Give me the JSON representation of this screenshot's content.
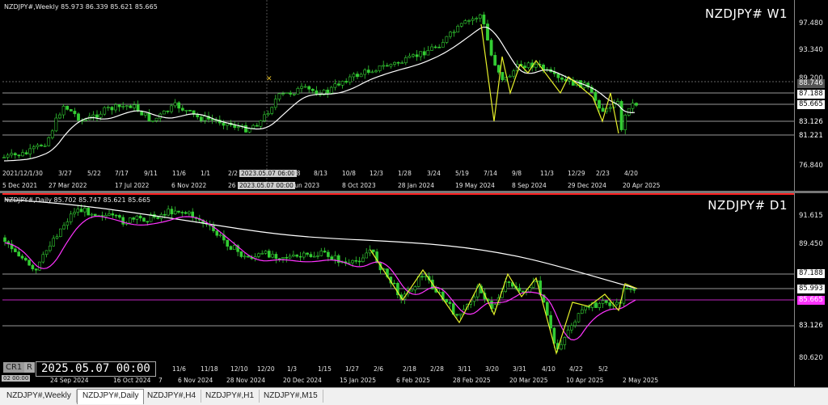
{
  "colors": {
    "bull": "#33cc33",
    "bear": "#33cc33",
    "ma_white": "#ffffff",
    "ma_magenta": "#ff33ff",
    "zigzag": "#e6f02a",
    "level": "#c8c8c8",
    "pivot_red": "#ff2020"
  },
  "top_pane": {
    "info": "NZDJPY#,Weekly  85.973 86.339 85.621 85.665",
    "big_label": "NZDJPY# W1",
    "y_ticks": [
      "97.480",
      "93.340",
      "89.200",
      "85.665",
      "83.126",
      "81.221",
      "76.840"
    ],
    "y_marks": [
      {
        "label": "88.746",
        "style": "grey"
      },
      {
        "label": "87.188",
        "style": "white"
      },
      {
        "label": "85.665",
        "style": "white"
      },
      {
        "label": "83.126",
        "style": "white"
      },
      {
        "label": "81.221",
        "style": "white"
      }
    ],
    "x_ticks": [
      "5 Dec 2021",
      "27 Mar 2022",
      "17 Jul 2022",
      "6 Nov 2022",
      "26",
      "2023.05.07 00:00",
      "Jun 2023",
      "8 Oct 2023",
      "28 Jan 2024",
      "19 May 2024",
      "8 Sep 2024",
      "29 Dec 2024",
      "20 Apr 2025"
    ],
    "x_ticks_upper": [
      "2021/12/",
      "1/30",
      "3/27",
      "5/22",
      "7/17",
      "9/11",
      "11/6",
      "1/1",
      "2/2",
      "2023.05.07 06:00",
      "18",
      "8/13",
      "10/8",
      "12/3",
      "1/28",
      "3/24",
      "5/19",
      "7/14",
      "9/8",
      "11/3",
      "12/29",
      "2/23",
      "4/20"
    ],
    "marker_symbol": "✕"
  },
  "bottom_pane": {
    "info": "NZDJPY#,Daily  85.702 85.747 85.621 85.665",
    "big_label": "NZDJPY# D1",
    "y_ticks": [
      "91.615",
      "89.450",
      "87.188",
      "85.993",
      "85.665",
      "83.126",
      "80.620"
    ],
    "y_marks": [
      {
        "label": "87.188",
        "style": "white"
      },
      {
        "label": "85.993",
        "style": "white"
      },
      {
        "label": "85.665",
        "style": "magenta"
      },
      {
        "label": "83.126",
        "style": "white"
      }
    ],
    "x_ticks": [
      "24 Sep 2024",
      "16 Oct 2024",
      "7",
      "6 Nov 2024",
      "28 Nov 2024",
      "20 Dec 2024",
      "15 Jan 2025",
      "6 Feb 2025",
      "28 Feb 2025",
      "20 Mar 2025",
      "10 Apr 2025",
      "2 May 2025"
    ],
    "x_ticks_upper": [
      "11/6",
      "11/18",
      "12/10",
      "12/20",
      "1/3",
      "1/15",
      "1/27",
      "2/6",
      "2/18",
      "2/28",
      "3/11",
      "3/20",
      "3/31",
      "4/10",
      "4/22",
      "5/2"
    ],
    "datetime_box": "2025.05.07 00:00",
    "c_label": "CR1",
    "r_label": "R",
    "corner_tick": "02 00:00"
  },
  "tabs": [
    {
      "label": "NZDJPY#,Weekly",
      "active": false
    },
    {
      "label": "NZDJPY#,Daily",
      "active": true
    },
    {
      "label": "NZDJPY#,H4",
      "active": false
    },
    {
      "label": "NZDJPY#,H1",
      "active": false
    },
    {
      "label": "NZDJPY#,M15",
      "active": false
    }
  ]
}
